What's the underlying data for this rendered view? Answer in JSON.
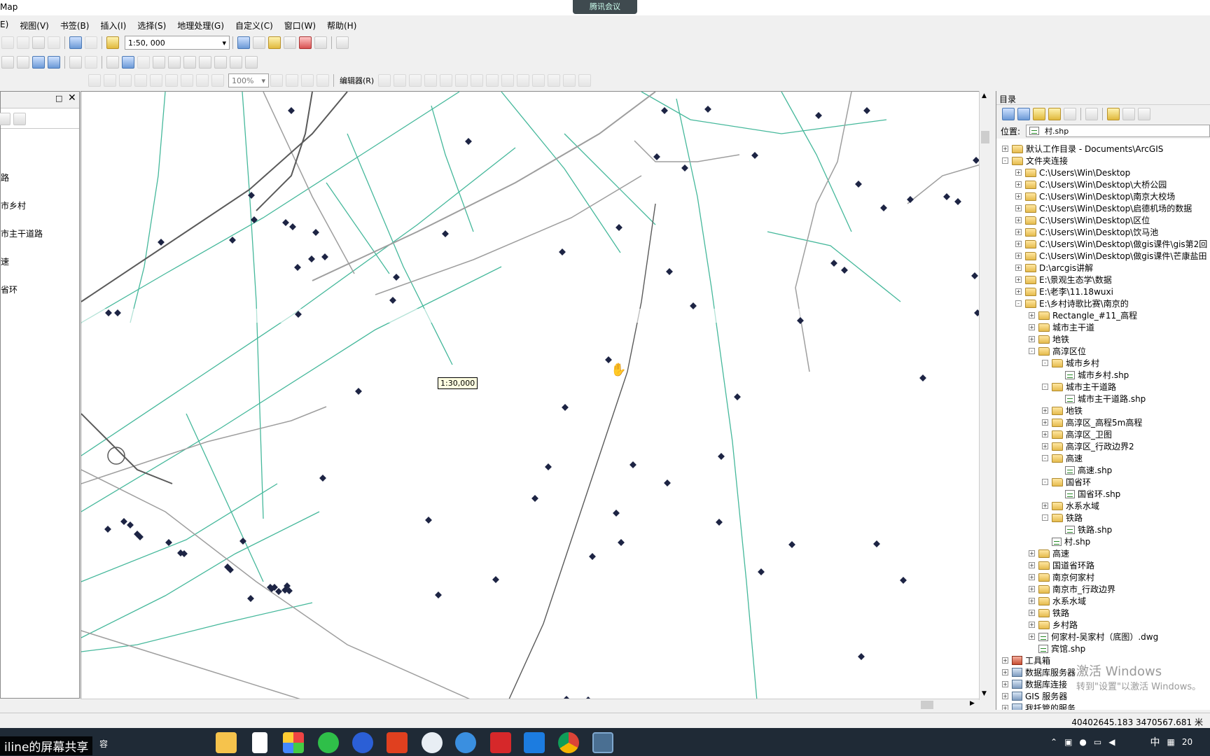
{
  "window": {
    "title": "Map",
    "meeting_label": "腾讯会议"
  },
  "menu": [
    "E)",
    "视图(V)",
    "书签(B)",
    "插入(I)",
    "选择(S)",
    "地理处理(G)",
    "自定义(C)",
    "窗口(W)",
    "帮助(H)"
  ],
  "toolbar": {
    "scale_value": "1:50, 000",
    "zoom_value": "100%",
    "editor_label": "编辑器(R)"
  },
  "left_panel": {
    "items": [
      "路",
      "市乡村",
      "市主干道路",
      "速",
      "省环"
    ]
  },
  "map": {
    "scale_tooltip": "1:30,000"
  },
  "catalog": {
    "title": "目录",
    "location_label": "位置:",
    "location_value": "村.shp",
    "tree": [
      {
        "text": "默认工作目录 - Documents\\ArcGIS",
        "exp": "+",
        "icon": "folder-home",
        "indent": 0
      },
      {
        "text": "文件夹连接",
        "exp": "-",
        "icon": "folder",
        "indent": 0
      },
      {
        "text": "C:\\Users\\Win\\Desktop",
        "exp": "+",
        "icon": "folder",
        "indent": 1
      },
      {
        "text": "C:\\Users\\Win\\Desktop\\大桥公园",
        "exp": "+",
        "icon": "folder",
        "indent": 1
      },
      {
        "text": "C:\\Users\\Win\\Desktop\\南京大校场",
        "exp": "+",
        "icon": "folder",
        "indent": 1
      },
      {
        "text": "C:\\Users\\Win\\Desktop\\启德机场的数据",
        "exp": "+",
        "icon": "folder",
        "indent": 1
      },
      {
        "text": "C:\\Users\\Win\\Desktop\\区位",
        "exp": "+",
        "icon": "folder",
        "indent": 1
      },
      {
        "text": "C:\\Users\\Win\\Desktop\\饮马池",
        "exp": "+",
        "icon": "folder",
        "indent": 1
      },
      {
        "text": "C:\\Users\\Win\\Desktop\\做gis课件\\gis第2回",
        "exp": "+",
        "icon": "folder",
        "indent": 1
      },
      {
        "text": "C:\\Users\\Win\\Desktop\\做gis课件\\芒康盐田",
        "exp": "+",
        "icon": "folder",
        "indent": 1
      },
      {
        "text": "D:\\arcgis讲解",
        "exp": "+",
        "icon": "folder",
        "indent": 1
      },
      {
        "text": "E:\\景观生态学\\数据",
        "exp": "+",
        "icon": "folder",
        "indent": 1
      },
      {
        "text": "E:\\老李\\11.18wuxi",
        "exp": "+",
        "icon": "folder",
        "indent": 1
      },
      {
        "text": "E:\\乡村诗歌比赛\\南京的",
        "exp": "-",
        "icon": "folder",
        "indent": 1
      },
      {
        "text": "Rectangle_#11_高程",
        "exp": "+",
        "icon": "folder",
        "indent": 2
      },
      {
        "text": "城市主干道",
        "exp": "+",
        "icon": "folder",
        "indent": 2
      },
      {
        "text": "地铁",
        "exp": "+",
        "icon": "folder",
        "indent": 2
      },
      {
        "text": "高淳区位",
        "exp": "-",
        "icon": "folder",
        "indent": 2
      },
      {
        "text": "城市乡村",
        "exp": "-",
        "icon": "folder",
        "indent": 3
      },
      {
        "text": "城市乡村.shp",
        "exp": "",
        "icon": "shp",
        "indent": 4
      },
      {
        "text": "城市主干道路",
        "exp": "-",
        "icon": "folder",
        "indent": 3
      },
      {
        "text": "城市主干道路.shp",
        "exp": "",
        "icon": "shp",
        "indent": 4
      },
      {
        "text": "地铁",
        "exp": "+",
        "icon": "folder",
        "indent": 3
      },
      {
        "text": "高淳区_高程5m高程",
        "exp": "+",
        "icon": "folder",
        "indent": 3
      },
      {
        "text": "高淳区_卫图",
        "exp": "+",
        "icon": "folder",
        "indent": 3
      },
      {
        "text": "高淳区_行政边界2",
        "exp": "+",
        "icon": "folder",
        "indent": 3
      },
      {
        "text": "高速",
        "exp": "-",
        "icon": "folder",
        "indent": 3
      },
      {
        "text": "高速.shp",
        "exp": "",
        "icon": "shp",
        "indent": 4
      },
      {
        "text": "国省环",
        "exp": "-",
        "icon": "folder",
        "indent": 3
      },
      {
        "text": "国省环.shp",
        "exp": "",
        "icon": "shp",
        "indent": 4
      },
      {
        "text": "水系水域",
        "exp": "+",
        "icon": "folder",
        "indent": 3
      },
      {
        "text": "铁路",
        "exp": "-",
        "icon": "folder",
        "indent": 3
      },
      {
        "text": "铁路.shp",
        "exp": "",
        "icon": "shp",
        "indent": 4
      },
      {
        "text": "村.shp",
        "exp": "",
        "icon": "shp",
        "indent": 3
      },
      {
        "text": "高速",
        "exp": "+",
        "icon": "folder",
        "indent": 2
      },
      {
        "text": "国道省环路",
        "exp": "+",
        "icon": "folder",
        "indent": 2
      },
      {
        "text": "南京何家村",
        "exp": "+",
        "icon": "folder",
        "indent": 2
      },
      {
        "text": "南京市_行政边界",
        "exp": "+",
        "icon": "folder",
        "indent": 2
      },
      {
        "text": "水系水域",
        "exp": "+",
        "icon": "folder",
        "indent": 2
      },
      {
        "text": "铁路",
        "exp": "+",
        "icon": "folder",
        "indent": 2
      },
      {
        "text": "乡村路",
        "exp": "+",
        "icon": "folder",
        "indent": 2
      },
      {
        "text": "何家村-吴家村（底图）.dwg",
        "exp": "+",
        "icon": "dwg",
        "indent": 2
      },
      {
        "text": "宾馆.shp",
        "exp": "",
        "icon": "shp",
        "indent": 2
      },
      {
        "text": "工具箱",
        "exp": "+",
        "icon": "toolbox",
        "indent": 0
      },
      {
        "text": "数据库服务器",
        "exp": "+",
        "icon": "gis",
        "indent": 0
      },
      {
        "text": "数据库连接",
        "exp": "+",
        "icon": "gis",
        "indent": 0
      },
      {
        "text": "GIS 服务器",
        "exp": "+",
        "icon": "gis",
        "indent": 0
      },
      {
        "text": "我托管的服务",
        "exp": "+",
        "icon": "gis",
        "indent": 0
      }
    ]
  },
  "watermark": {
    "line1": "激活 Windows",
    "line2": "转到\"设置\"以激活 Windows。"
  },
  "status": {
    "coords": "40402645.183  3470567.681 米"
  },
  "taskbar": {
    "share_label": "iline的屏幕共享",
    "share_suffix": "容",
    "ime": "中",
    "year_partial": "20"
  },
  "colors": {
    "river": "#45b89b",
    "road": "#9e9e9e",
    "point": "#1d2444",
    "highway": "#5a5a5a"
  }
}
